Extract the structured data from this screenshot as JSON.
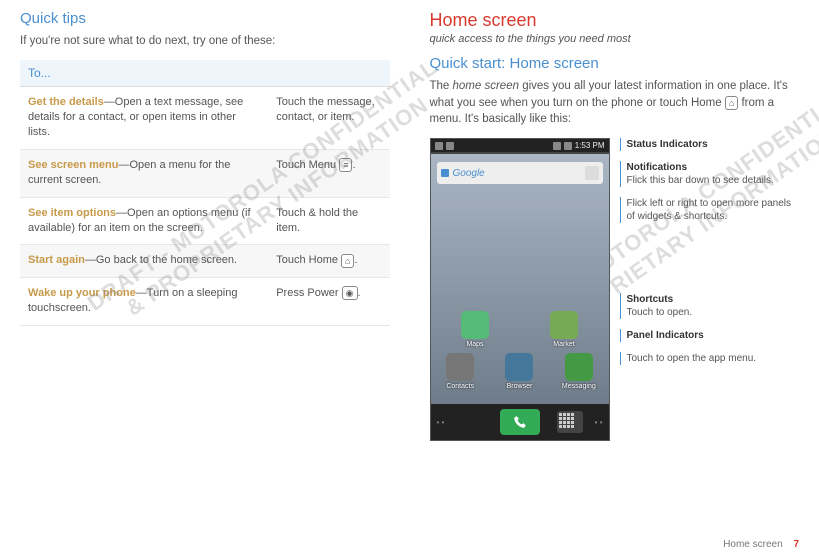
{
  "left": {
    "heading": "Quick tips",
    "intro": "If you're not sure what to do next, try one of these:",
    "th": "To...",
    "rows": [
      {
        "action": "Get the details",
        "desc": "—Open a text message, see details for a contact, or open items in other lists.",
        "do": "Touch the message, contact, or item."
      },
      {
        "action": "See screen menu",
        "desc": "—Open a menu for the current screen.",
        "do_pre": "Touch Menu ",
        "key": "≡",
        "do_post": "."
      },
      {
        "action": "See item options",
        "desc": "—Open an options menu (if available) for an item on the screen.",
        "do": "Touch & hold the item."
      },
      {
        "action": "Start again",
        "desc": "—Go back to the home screen.",
        "do_pre": "Touch Home ",
        "key": "⌂",
        "do_post": "."
      },
      {
        "action": "Wake up your phone",
        "desc": "—Turn on a sleeping touchscreen.",
        "do_pre": "Press Power ",
        "key": "◉",
        "do_post": "."
      }
    ]
  },
  "right": {
    "h1": "Home screen",
    "sub": "quick access to the things you need most",
    "h2": "Quick start: Home screen",
    "p_pre": "The ",
    "p_em": "home screen",
    "p_mid": " gives you all your latest information in one place. It's what you see when you turn on the phone or touch Home ",
    "home_key": "⌂",
    "p_post": " from a menu. It's basically like this:",
    "status_time": "1:53 PM",
    "search_label": "Google",
    "apps_row1": [
      "Maps",
      "Market"
    ],
    "apps_row2": [
      "Contacts",
      "Browser",
      "Messaging"
    ],
    "annot": {
      "status": {
        "t": "Status Indicators"
      },
      "notif": {
        "t": "Notifications",
        "d": "Flick this bar down to see details."
      },
      "panels": {
        "d": "Flick left or right to open more panels of widgets & shortcuts."
      },
      "shortcuts": {
        "t": "Shortcuts",
        "d": "Touch to open."
      },
      "panel_ind": {
        "t": "Panel Indicators"
      },
      "appmenu": {
        "d": "Touch to open the app menu."
      }
    }
  },
  "watermark": "DRAFT - MOTOROLA CONFIDENTIAL\n& PROPRIETARY INFORMATION",
  "footer": {
    "label": "Home screen",
    "page": "7"
  }
}
